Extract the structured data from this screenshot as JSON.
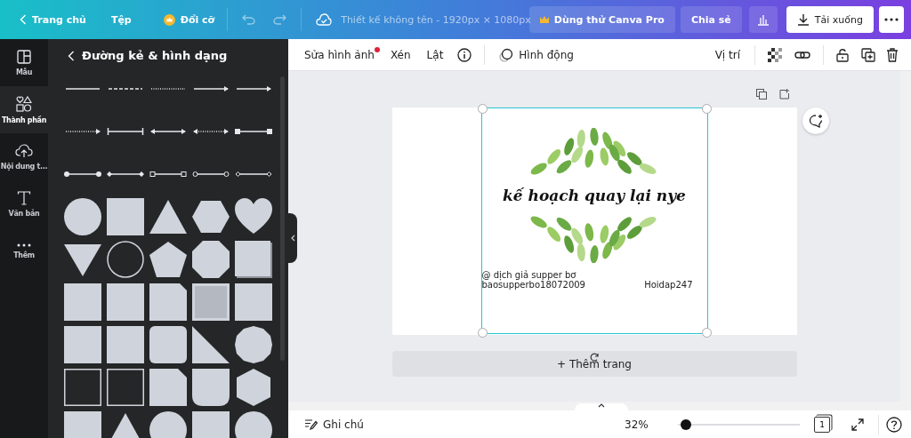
{
  "top_bar": {
    "home": "Trang chủ",
    "file": "Tệp",
    "resize": "Đổi cỡ",
    "title": "Thiết kế không tên - 1920px × 1080px",
    "pro": "Dùng thử Canva Pro",
    "share": "Chia sẻ",
    "download": "Tải xuống"
  },
  "rail": [
    {
      "label": "Mẫu",
      "selected": false
    },
    {
      "label": "Thành phần",
      "selected": true
    },
    {
      "label": "Nội dung t...",
      "selected": false
    },
    {
      "label": "Văn bản",
      "selected": false
    },
    {
      "label": "Thêm",
      "selected": false
    }
  ],
  "panel": {
    "title": "Đường kẻ & hình dạng"
  },
  "toolbar": {
    "edit_image": "Sửa hình ảnh",
    "edit_image_badge": true,
    "crop": "Xén",
    "flip": "Lật",
    "animate": "Hình động",
    "position": "Vị trí"
  },
  "design": {
    "title": "kế hoạch quay lại nye",
    "credit_line_1": "@ dịch giả supper bơ",
    "credit_line_2": "baosupperbo18072009",
    "watermark": "Hoidap247",
    "selected": true
  },
  "add_page": "+ Thêm trang",
  "bottom_bar": {
    "notes": "Ghi chú",
    "zoom": "32%",
    "zoom_slider": {
      "level": 0.02
    },
    "page_count": "1"
  }
}
